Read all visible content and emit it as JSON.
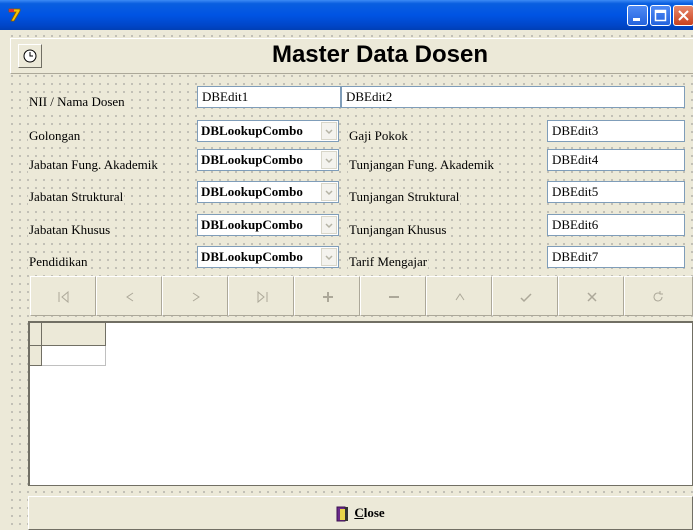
{
  "window": {
    "title": "",
    "header_title": "Master Data Dosen"
  },
  "form": {
    "fields": [
      {
        "label": "NII / Nama Dosen",
        "value1": "DBEdit1",
        "value2": "DBEdit2"
      },
      {
        "left_label": "Golongan",
        "combo": "DBLookupCombo",
        "right_label": "Gaji Pokok",
        "edit": "DBEdit3"
      },
      {
        "left_label": "Jabatan Fung. Akademik",
        "combo": "DBLookupCombo",
        "right_label": "Tunjangan Fung. Akademik",
        "edit": "DBEdit4"
      },
      {
        "left_label": "Jabatan Struktural",
        "combo": "DBLookupCombo",
        "right_label": "Tunjangan Struktural",
        "edit": "DBEdit5"
      },
      {
        "left_label": "Jabatan Khusus",
        "combo": "DBLookupCombo",
        "right_label": "Tunjangan Khusus",
        "edit": "DBEdit6"
      },
      {
        "left_label": "Pendidikan",
        "combo": "DBLookupCombo",
        "right_label": "Tarif Mengajar",
        "edit": "DBEdit7"
      }
    ]
  },
  "navigator": {
    "buttons": [
      "first-icon",
      "prior-icon",
      "next-icon",
      "last-icon",
      "insert-icon",
      "delete-icon",
      "edit-icon",
      "post-icon",
      "cancel-icon",
      "refresh-icon"
    ]
  },
  "footer": {
    "close_underlined": "C",
    "close_rest": "lose"
  },
  "colors": {
    "title_bar": "#0054e3",
    "face": "#ece9d8",
    "close_button_red": "#c8411f"
  }
}
